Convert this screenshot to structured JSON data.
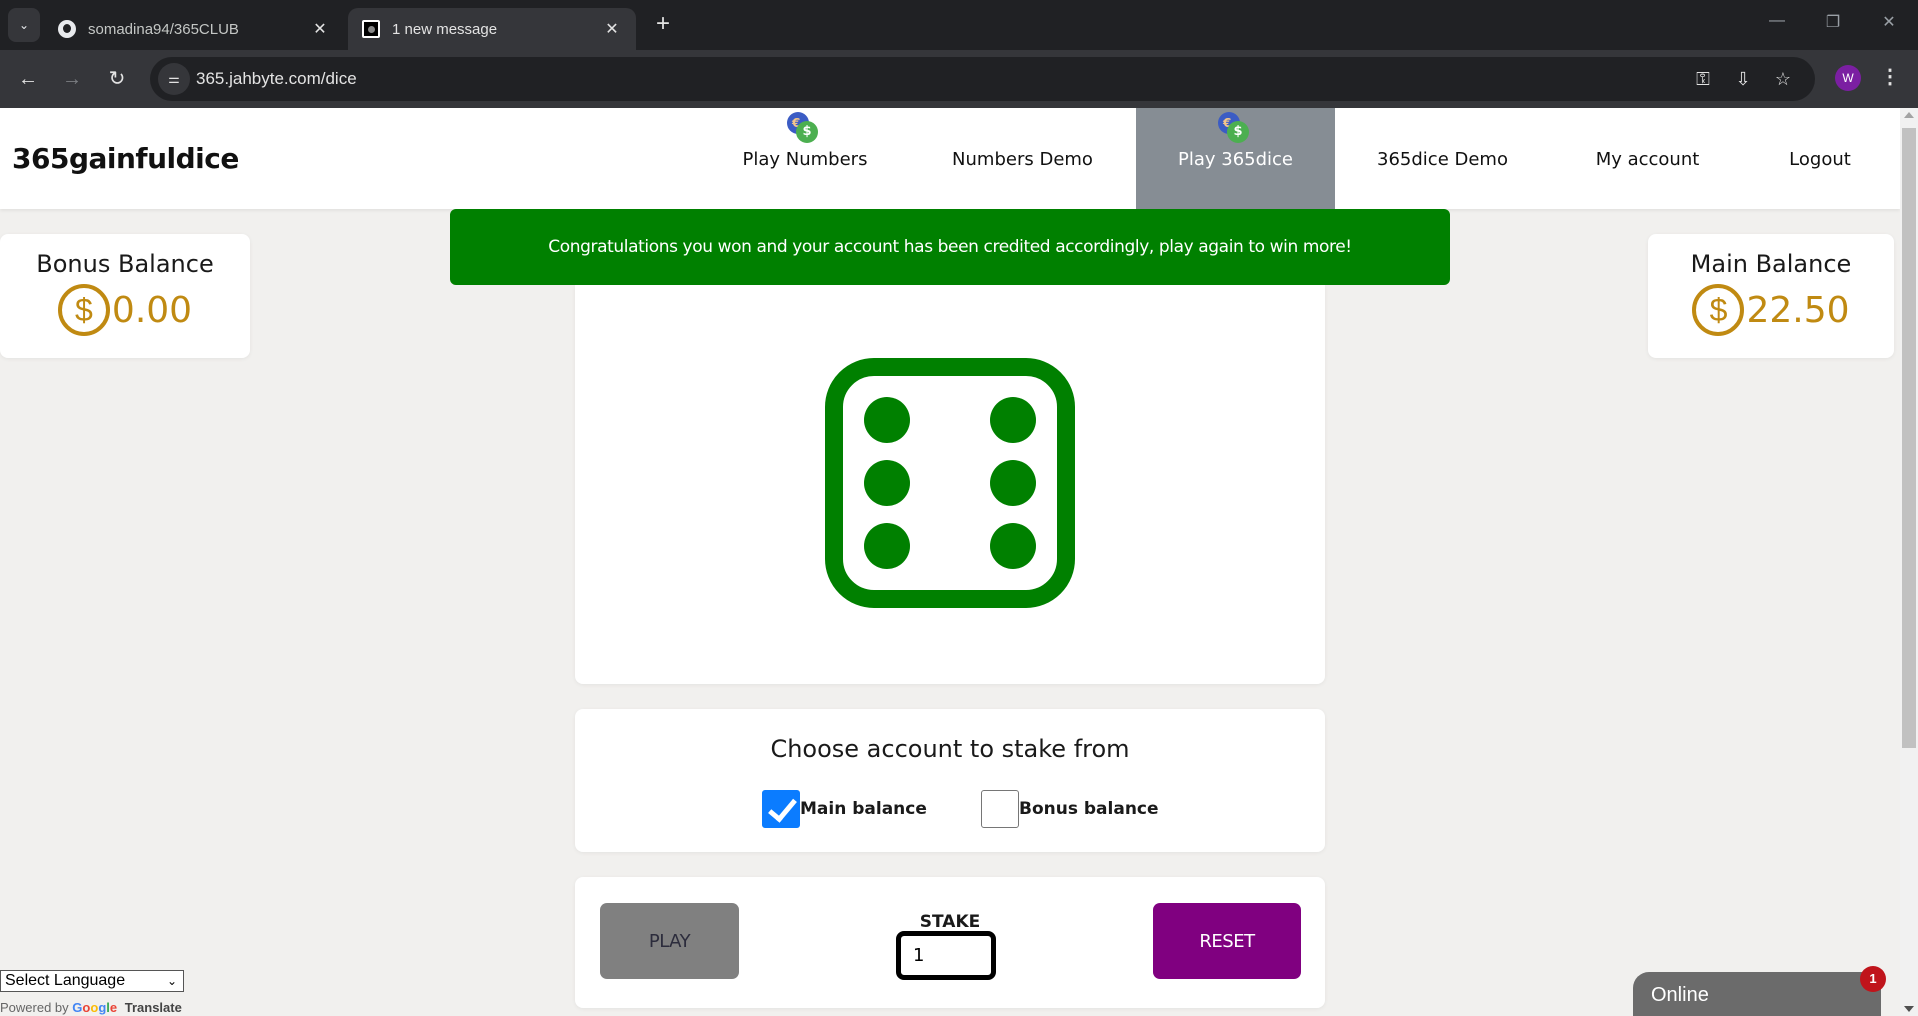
{
  "browser": {
    "tabs": [
      {
        "title": "somadina94/365CLUB",
        "icon": "github-icon",
        "active": false
      },
      {
        "title": "1 new message",
        "icon": "site-favicon",
        "active": true
      }
    ],
    "new_tab": "+",
    "tab_close": "✕",
    "tab_list": "⌄",
    "window_controls": {
      "minimize": "—",
      "restore": "❐",
      "close": "✕"
    },
    "nav": {
      "back": "←",
      "forward": "→",
      "reload": "↻"
    },
    "url": "365.jahbyte.com/dice",
    "site_info_icon": "⚌",
    "omnibox_icons": {
      "password": "⚿",
      "install": "⇩",
      "bookmark": "☆"
    },
    "profile_initial": "W",
    "menu": "⋮"
  },
  "site": {
    "brand": "365gainfuldice",
    "nav": [
      {
        "label": "Play Numbers",
        "has_icon": true,
        "active": false
      },
      {
        "label": "Numbers Demo",
        "has_icon": false,
        "active": false
      },
      {
        "label": "Play 365dice",
        "has_icon": true,
        "active": true
      },
      {
        "label": "365dice Demo",
        "has_icon": false,
        "active": false
      },
      {
        "label": "My account",
        "has_icon": false,
        "active": false
      },
      {
        "label": "Logout",
        "has_icon": false,
        "active": false
      }
    ],
    "coin_icon": {
      "euro": "€",
      "dollar": "$"
    }
  },
  "alert": {
    "message": "Congratulations you won and your account has been credited accordingly, play again to win more!",
    "color": "#008000"
  },
  "balances": {
    "bonus": {
      "label": "Bonus Balance",
      "currency_symbol": "$",
      "amount": "0.00"
    },
    "main": {
      "label": "Main Balance",
      "currency_symbol": "$",
      "amount": "22.50"
    },
    "accent": "#c08a12"
  },
  "dice": {
    "value": 6,
    "color": "#008000"
  },
  "stake_account": {
    "title": "Choose account to stake from",
    "options": [
      {
        "label": "Main balance",
        "checked": true
      },
      {
        "label": "Bonus balance",
        "checked": false
      }
    ]
  },
  "controls": {
    "play_label": "PLAY",
    "reset_label": "RESET",
    "stake_label": "STAKE",
    "stake_value": "1"
  },
  "translate": {
    "select_label": "Select Language",
    "powered_by": "Powered by",
    "google": "Google",
    "translate": "Translate"
  },
  "chat": {
    "status": "Online",
    "unread": "1"
  }
}
